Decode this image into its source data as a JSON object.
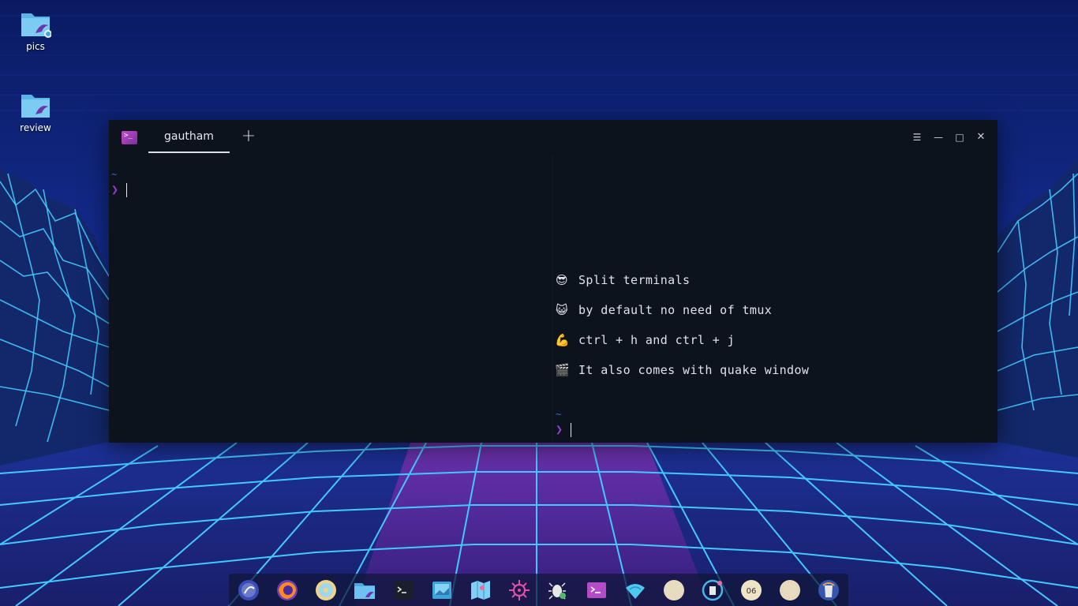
{
  "desktop": {
    "icons": [
      {
        "label": "pics",
        "icon": "folder-icon"
      },
      {
        "label": "review",
        "icon": "folder-icon"
      }
    ]
  },
  "terminal": {
    "app_icon": "terminal-app-icon",
    "tab_label": "gautham",
    "new_tab_icon": "plus-icon",
    "controls": [
      "menu-icon",
      "minimize-icon",
      "maximize-icon",
      "close-icon"
    ],
    "left_pane": {
      "tilde": "~",
      "prompt": "❯"
    },
    "right_pane": {
      "lines": [
        {
          "emoji": "😎",
          "text": "Split terminals"
        },
        {
          "emoji": "😺",
          "text": "by default no need of tmux"
        },
        {
          "emoji": "💪",
          "text": "ctrl + h and ctrl + j"
        },
        {
          "emoji": "🎬",
          "text": "It also comes with quake window"
        }
      ],
      "tilde": "~",
      "prompt": "❯"
    }
  },
  "dock": {
    "items": [
      "launcher-icon",
      "firefox-icon",
      "disc-player-icon",
      "file-manager-icon",
      "terminal-icon",
      "image-viewer-icon",
      "maps-icon",
      "settings-wheel-icon",
      "bug-tool-icon",
      "deepin-terminal-icon",
      "wifi-icon",
      "blank-app-icon",
      "notification-icon",
      "clock-icon",
      "blank-app-2-icon",
      "trash-icon"
    ],
    "clock_text": "06"
  },
  "colors": {
    "terminal_bg": "#0d131d",
    "prompt": "#8f3fd0",
    "tilde": "#3a6fc8",
    "grid_line": "#43c9ff",
    "wallpaper_top": "#0a1a63"
  }
}
